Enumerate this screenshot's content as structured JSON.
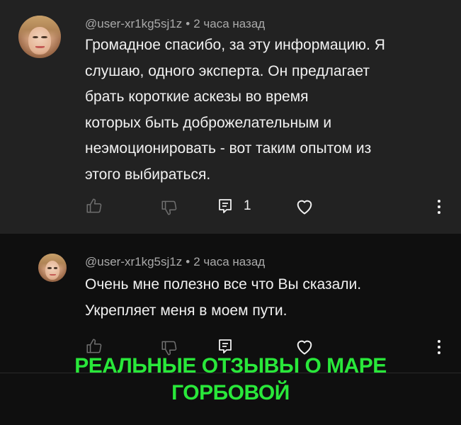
{
  "comments": [
    {
      "author": "@user-xr1kg5sj1z",
      "separator": "•",
      "time": "2 часа назад",
      "lines": [
        "Громадное спасибо, за эту информацию. Я",
        "слушаю, одного эксперта. Он предлагает",
        "брать короткие аскезы во время",
        "которых быть доброжелательным и",
        "неэмоционировать - вот таким опытом из",
        "этого выбираться."
      ],
      "reply_count": "1"
    },
    {
      "author": "@user-xr1kg5sj1z",
      "separator": "•",
      "time": "2 часа назад",
      "lines": [
        "Очень мне полезно все что Вы сказали.",
        "Укрепляет меня в моем пути."
      ]
    }
  ],
  "overlay": {
    "line1": "РЕАЛЬНЫЕ ОТЗЫВЫ О МАРЕ",
    "line2": "ГОРБОВОЙ"
  },
  "colors": {
    "highlight_bg": "#222222",
    "bg": "#0f0f0f",
    "overlay_text": "#29e83a"
  },
  "icons": [
    "thumbs-up-icon",
    "thumbs-down-icon",
    "reply-icon",
    "heart-icon",
    "more-vert-icon"
  ]
}
